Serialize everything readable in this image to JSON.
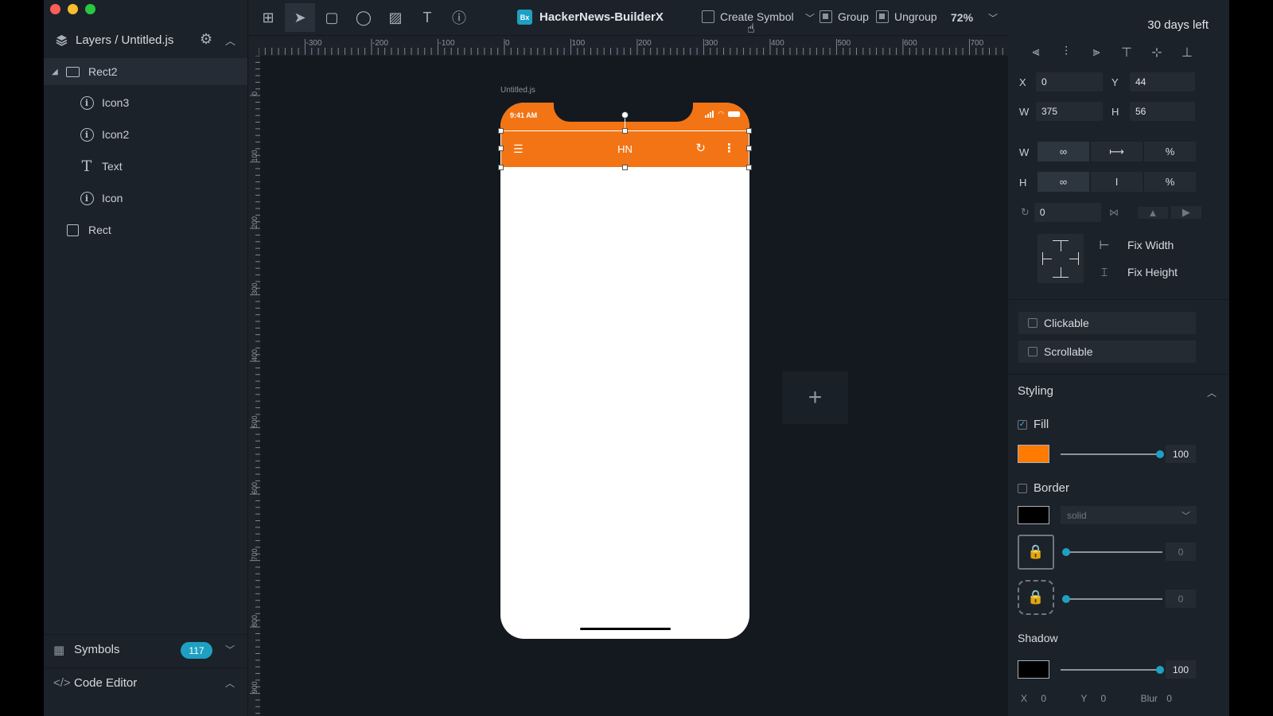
{
  "window": {
    "traffic_lights": [
      "close",
      "minimize",
      "maximize"
    ]
  },
  "sidebar": {
    "title": "Layers / Untitled.js",
    "layers": [
      {
        "name": "Rect2",
        "icon": "folder-icon"
      },
      {
        "name": "Icon3",
        "icon": "info-icon"
      },
      {
        "name": "Icon2",
        "icon": "info-icon"
      },
      {
        "name": "Text",
        "icon": "text-icon"
      },
      {
        "name": "Icon",
        "icon": "info-icon"
      },
      {
        "name": "Rect",
        "icon": "rectangle-icon"
      }
    ],
    "symbols_label": "Symbols",
    "symbols_count": "117",
    "code_editor_label": "Code Editor"
  },
  "toolbar": {
    "app_title": "HackerNews-BuilderX",
    "logo_text": "Bx",
    "create_symbol": "Create Symbol",
    "group": "Group",
    "ungroup": "Ungroup",
    "zoom": "72%"
  },
  "rulers": {
    "top_labels": [
      "-300",
      "-200",
      "-100",
      "0",
      "100",
      "200",
      "300",
      "400",
      "500",
      "600",
      "700"
    ],
    "left_labels": [
      "0",
      "100",
      "200",
      "300",
      "400",
      "500",
      "600",
      "700",
      "800",
      "900"
    ]
  },
  "canvas": {
    "file_label": "Untitled.js",
    "status_time": "9:41 AM",
    "nav_title": "HN",
    "accent": "#f27414"
  },
  "inspector": {
    "trial": "30 days left",
    "x_label": "X",
    "x": "0",
    "y_label": "Y",
    "y": "44",
    "w_label": "W",
    "w": "375",
    "h_label": "H",
    "h": "56",
    "w_mode_label": "W",
    "h_mode_label": "H",
    "pct": "%",
    "inf": "∞",
    "rotation": "0",
    "fix_width": "Fix Width",
    "fix_height": "Fix Height",
    "clickable": "Clickable",
    "scrollable": "Scrollable",
    "styling": "Styling",
    "fill_label": "Fill",
    "fill_color": "#ff7a00",
    "fill_opacity": "100",
    "border_label": "Border",
    "border_color": "#000000",
    "border_style": "solid",
    "border_width": "0",
    "border_radius": "0",
    "shadow_label": "Shadow",
    "shadow_color": "#000000",
    "shadow_opacity": "100",
    "shadow_x_label": "X",
    "shadow_x": "0",
    "shadow_y_label": "Y",
    "shadow_y": "0",
    "shadow_blur_label": "Blur",
    "shadow_blur": "0"
  }
}
